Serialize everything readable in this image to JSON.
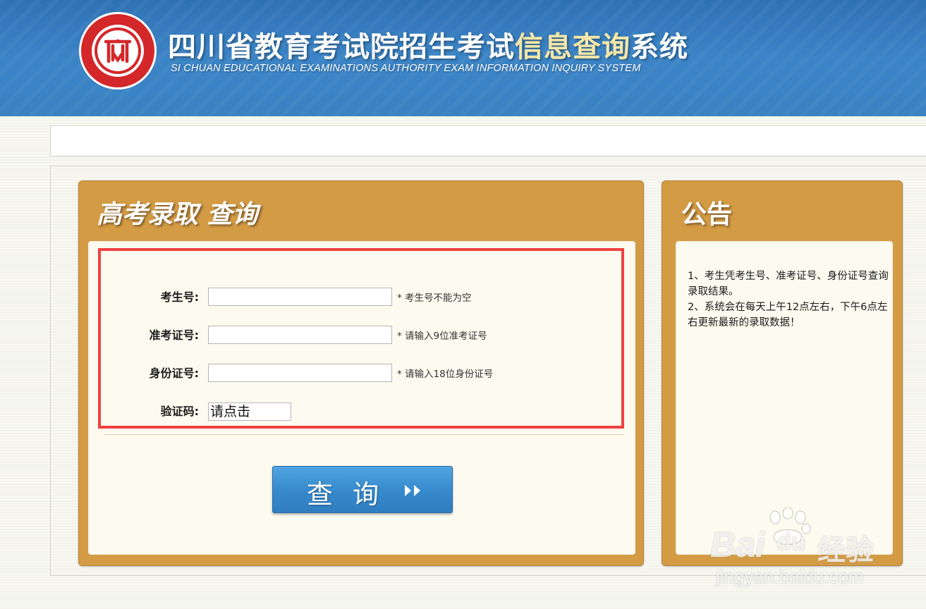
{
  "header": {
    "title_part1": "四川省教育考试院招生考试",
    "title_highlight": "信息查询",
    "title_part2": "系统",
    "subtitle": "SI CHUAN EDUCATIONAL EXAMINATIONS AUTHORITY EXAM INFORMATION INQUIRY SYSTEM",
    "logo_icon": "sceea-seal-logo"
  },
  "query_panel": {
    "title": "高考录取  查询",
    "fields": [
      {
        "label": "考生号:",
        "value": "",
        "hint": "* 考生号不能为空"
      },
      {
        "label": "准考证号:",
        "value": "",
        "hint": "* 请输入9位准考证号"
      },
      {
        "label": "身份证号:",
        "value": "",
        "hint": "* 请输入18位身份证号"
      }
    ],
    "captcha": {
      "label": "验证码:",
      "value": "请点击"
    },
    "submit_label": "查询",
    "submit_icon": "double-chevron-right-icon"
  },
  "notice_panel": {
    "title": "公告",
    "lines": [
      "1、考生凭考生号、准考证号、身份证号查询录取结果。",
      "2、系统会在每天上午12点左右，下午6点左右更新最新的录取数据！"
    ]
  },
  "watermark": {
    "brand": "Bai",
    "brand2": "du",
    "cn": "经验",
    "url": "jingyan.baidu.com"
  },
  "colors": {
    "header_blue": "#3a82c2",
    "panel_orange": "#d49b45",
    "panel_inner": "#fdfbf0",
    "highlight_red": "#f04040",
    "button_blue": "#3689cc"
  }
}
